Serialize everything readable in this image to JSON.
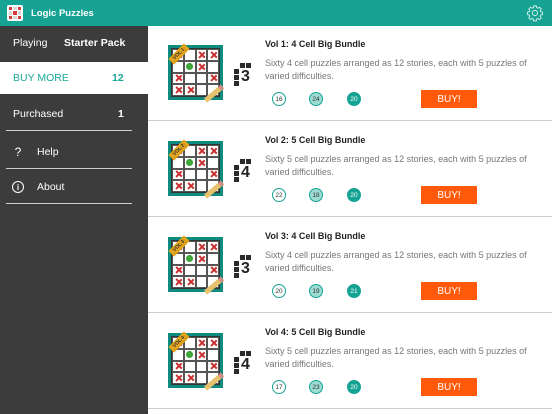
{
  "app": {
    "title": "Logic Puzzles",
    "accent_color": "#16a394",
    "settings_icon": "gear-icon"
  },
  "sidebar": {
    "playing_label": "Playing",
    "playing_value": "Starter Pack",
    "buy_more_label": "BUY MORE",
    "buy_more_count": "12",
    "purchased_label": "Purchased",
    "purchased_count": "1",
    "help_label": "Help",
    "help_icon": "question-icon",
    "about_label": "About",
    "about_icon": "info-icon"
  },
  "bundles": [
    {
      "title": "Vol 1: 4 Cell Big Bundle",
      "description": "Sixty 4 cell puzzles arranged as 12 stories, each with 5 puzzles of varied difficulties.",
      "size": "3",
      "ribbon": "VOL 1",
      "badges": [
        "16",
        "24",
        "20"
      ],
      "buy_label": "BUY!"
    },
    {
      "title": "Vol 2: 5 Cell Big Bundle",
      "description": "Sixty 5 cell puzzles arranged as 12 stories, each with 5 puzzles of varied difficulties.",
      "size": "4",
      "ribbon": "VOL 2",
      "badges": [
        "22",
        "18",
        "20"
      ],
      "buy_label": "BUY!"
    },
    {
      "title": "Vol 3: 4 Cell Big Bundle",
      "description": "Sixty 4 cell puzzles arranged as 12 stories, each with 5 puzzles of varied difficulties.",
      "size": "3",
      "ribbon": "VOL 3",
      "badges": [
        "20",
        "19",
        "21"
      ],
      "buy_label": "BUY!"
    },
    {
      "title": "Vol 4: 5 Cell Big Bundle",
      "description": "Sixty 5 cell puzzles arranged as 12 stories, each with 5 puzzles of varied difficulties.",
      "size": "4",
      "ribbon": "VOL 4",
      "badges": [
        "17",
        "23",
        "20"
      ],
      "buy_label": "BUY!"
    }
  ],
  "colors": {
    "buy_button": "#ff5a0a",
    "sidebar_bg": "#3c3c3c"
  }
}
